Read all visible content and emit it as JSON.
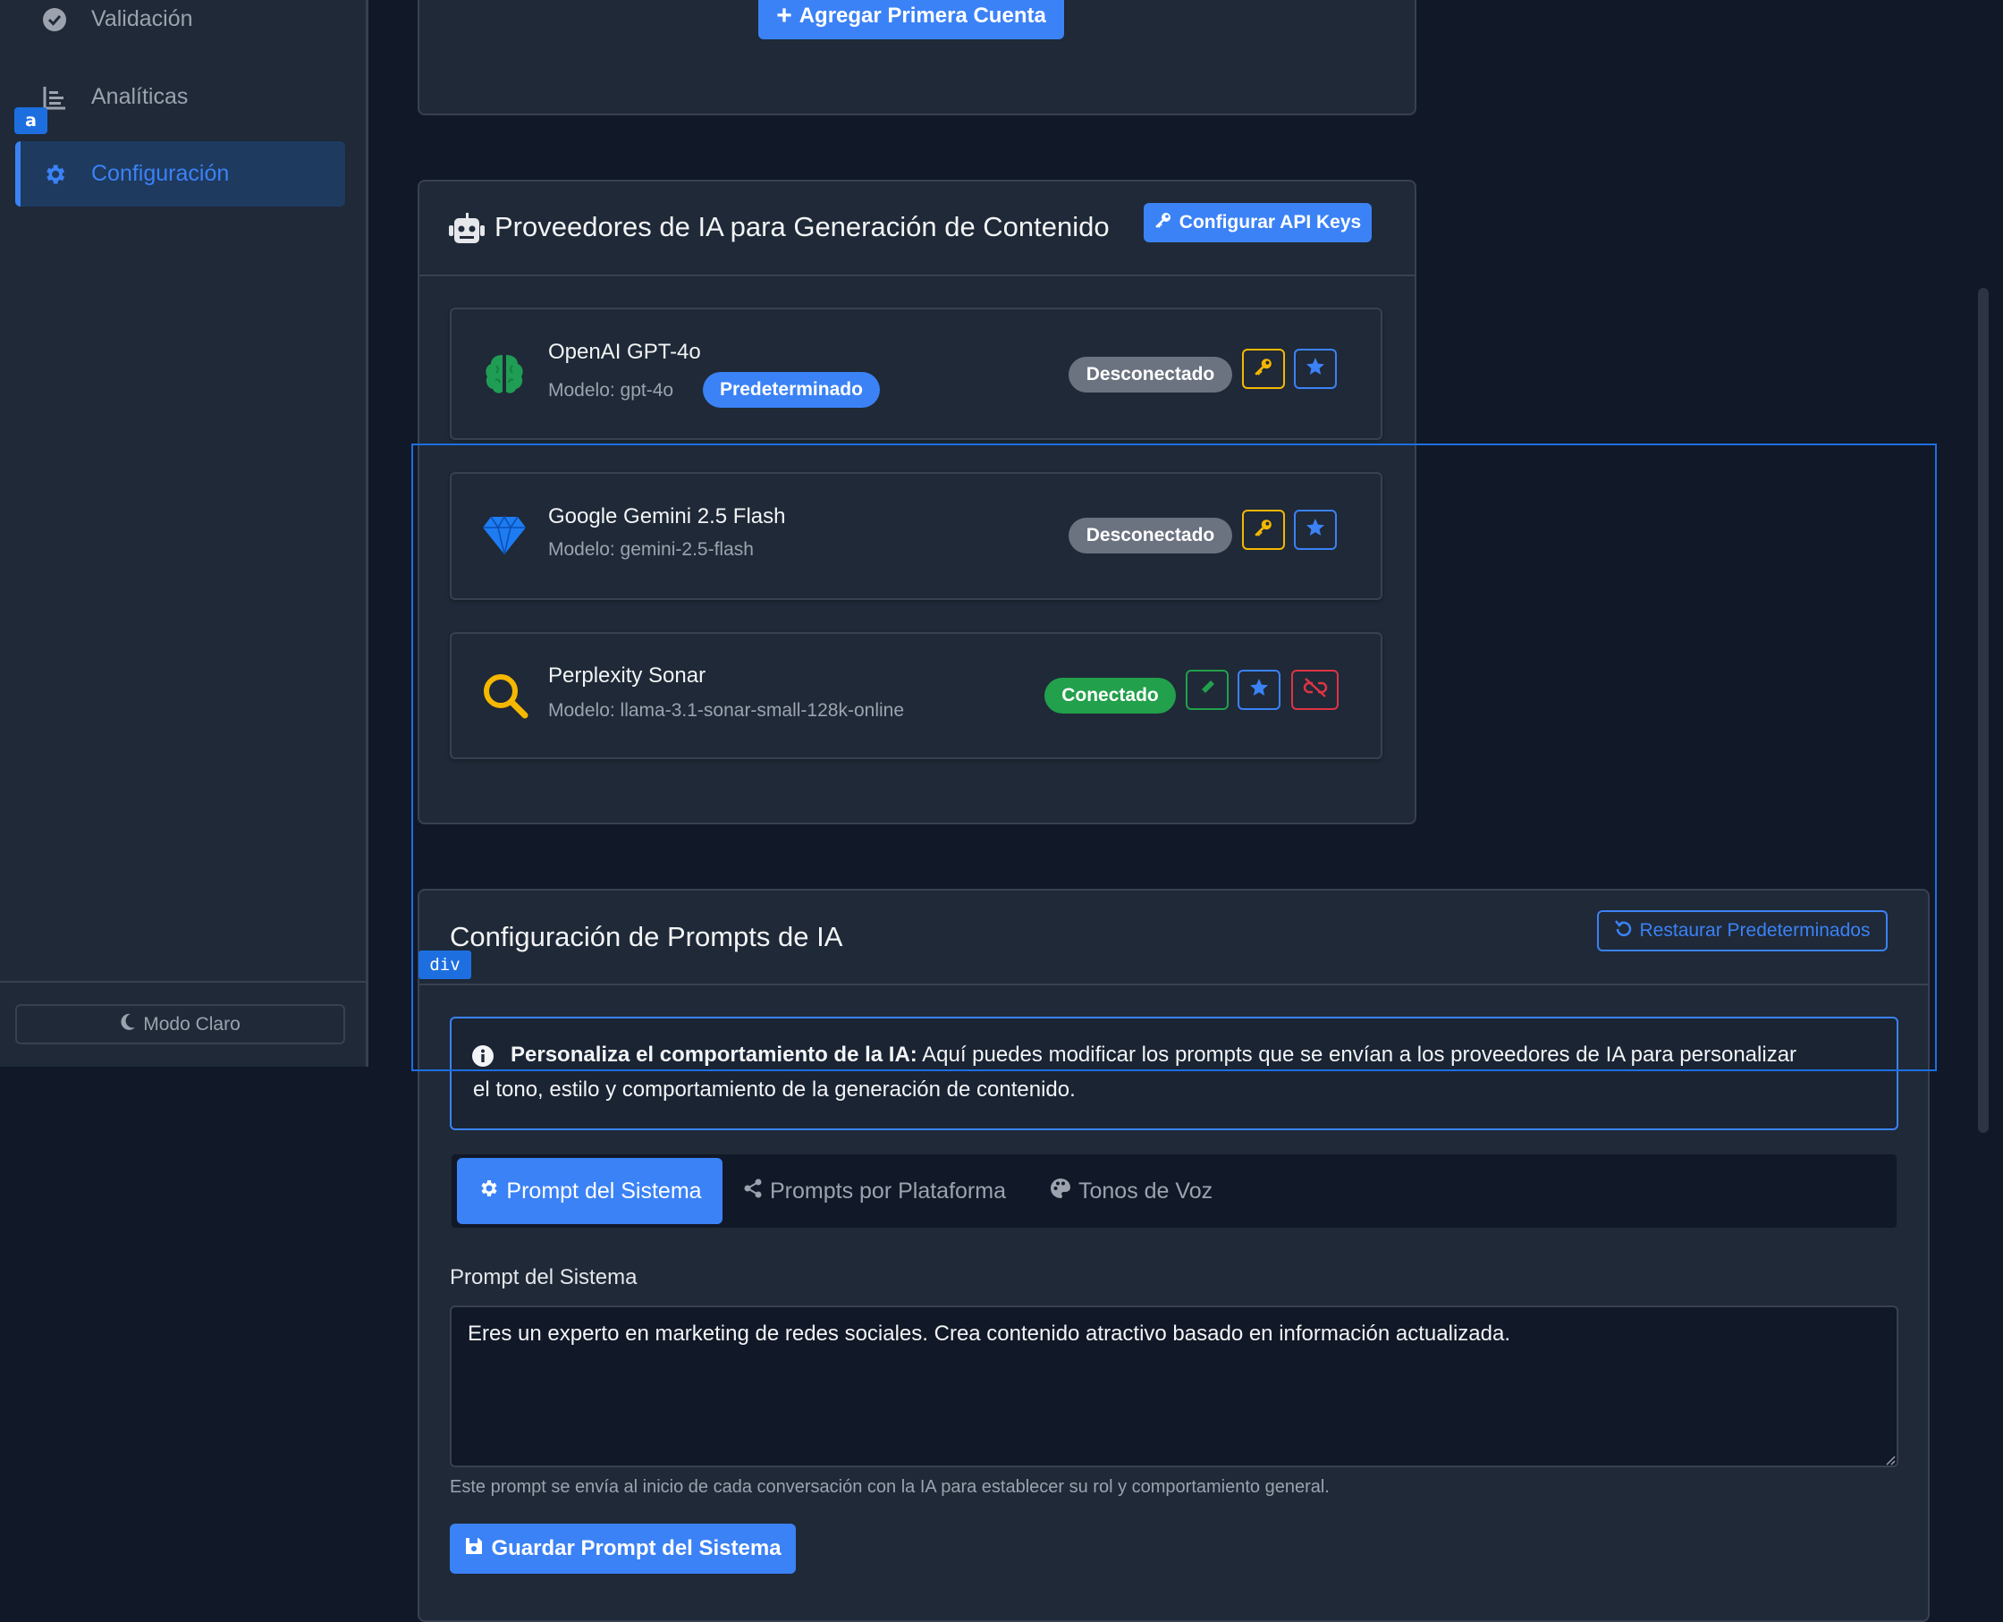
{
  "sidebar": {
    "items": [
      {
        "label": "Validación",
        "icon": "check-circle-icon"
      },
      {
        "label": "Analíticas",
        "icon": "bar-chart-icon"
      },
      {
        "label": "Configuración",
        "icon": "gear-icon",
        "active": true
      }
    ],
    "mode_button": "Modo Claro"
  },
  "overlay": {
    "element_badge": "a",
    "div_badge": "div"
  },
  "accounts": {
    "add_button": "Agregar Primera Cuenta"
  },
  "providers": {
    "title": "Proveedores de IA para Generación de Contenido",
    "config_button": "Configurar API Keys",
    "list": [
      {
        "name": "OpenAI GPT-4o",
        "model": "Modelo: gpt-4o",
        "default_badge": "Predeterminado",
        "status": "Desconectado"
      },
      {
        "name": "Google Gemini 2.5 Flash",
        "model": "Modelo: gemini-2.5-flash",
        "status": "Desconectado"
      },
      {
        "name": "Perplexity Sonar",
        "model": "Modelo: llama-3.1-sonar-small-128k-online",
        "status": "Conectado"
      }
    ]
  },
  "prompts": {
    "title": "Configuración de Prompts de IA",
    "restore_button": "Restaurar Predeterminados",
    "info_bold": "Personaliza el comportamiento de la IA:",
    "info_text_1": " Aquí puedes modificar los prompts que se envían a los proveedores de IA para personalizar",
    "info_text_2": "el tono, estilo y comportamiento de la generación de contenido.",
    "tabs": [
      "Prompt del Sistema",
      "Prompts por Plataforma",
      "Tonos de Voz"
    ],
    "field_label": "Prompt del Sistema",
    "field_value": "Eres un experto en marketing de redes sociales. Crea contenido atractivo basado en información actualizada.",
    "help_text": "Este prompt se envía al inicio de cada conversación con la IA para establecer su rol y comportamiento general.",
    "save_button": "Guardar Prompt del Sistema"
  },
  "colors": {
    "accent": "#3b82f6",
    "success": "#22a04b",
    "warning": "#f5b800",
    "danger": "#dc3545"
  }
}
